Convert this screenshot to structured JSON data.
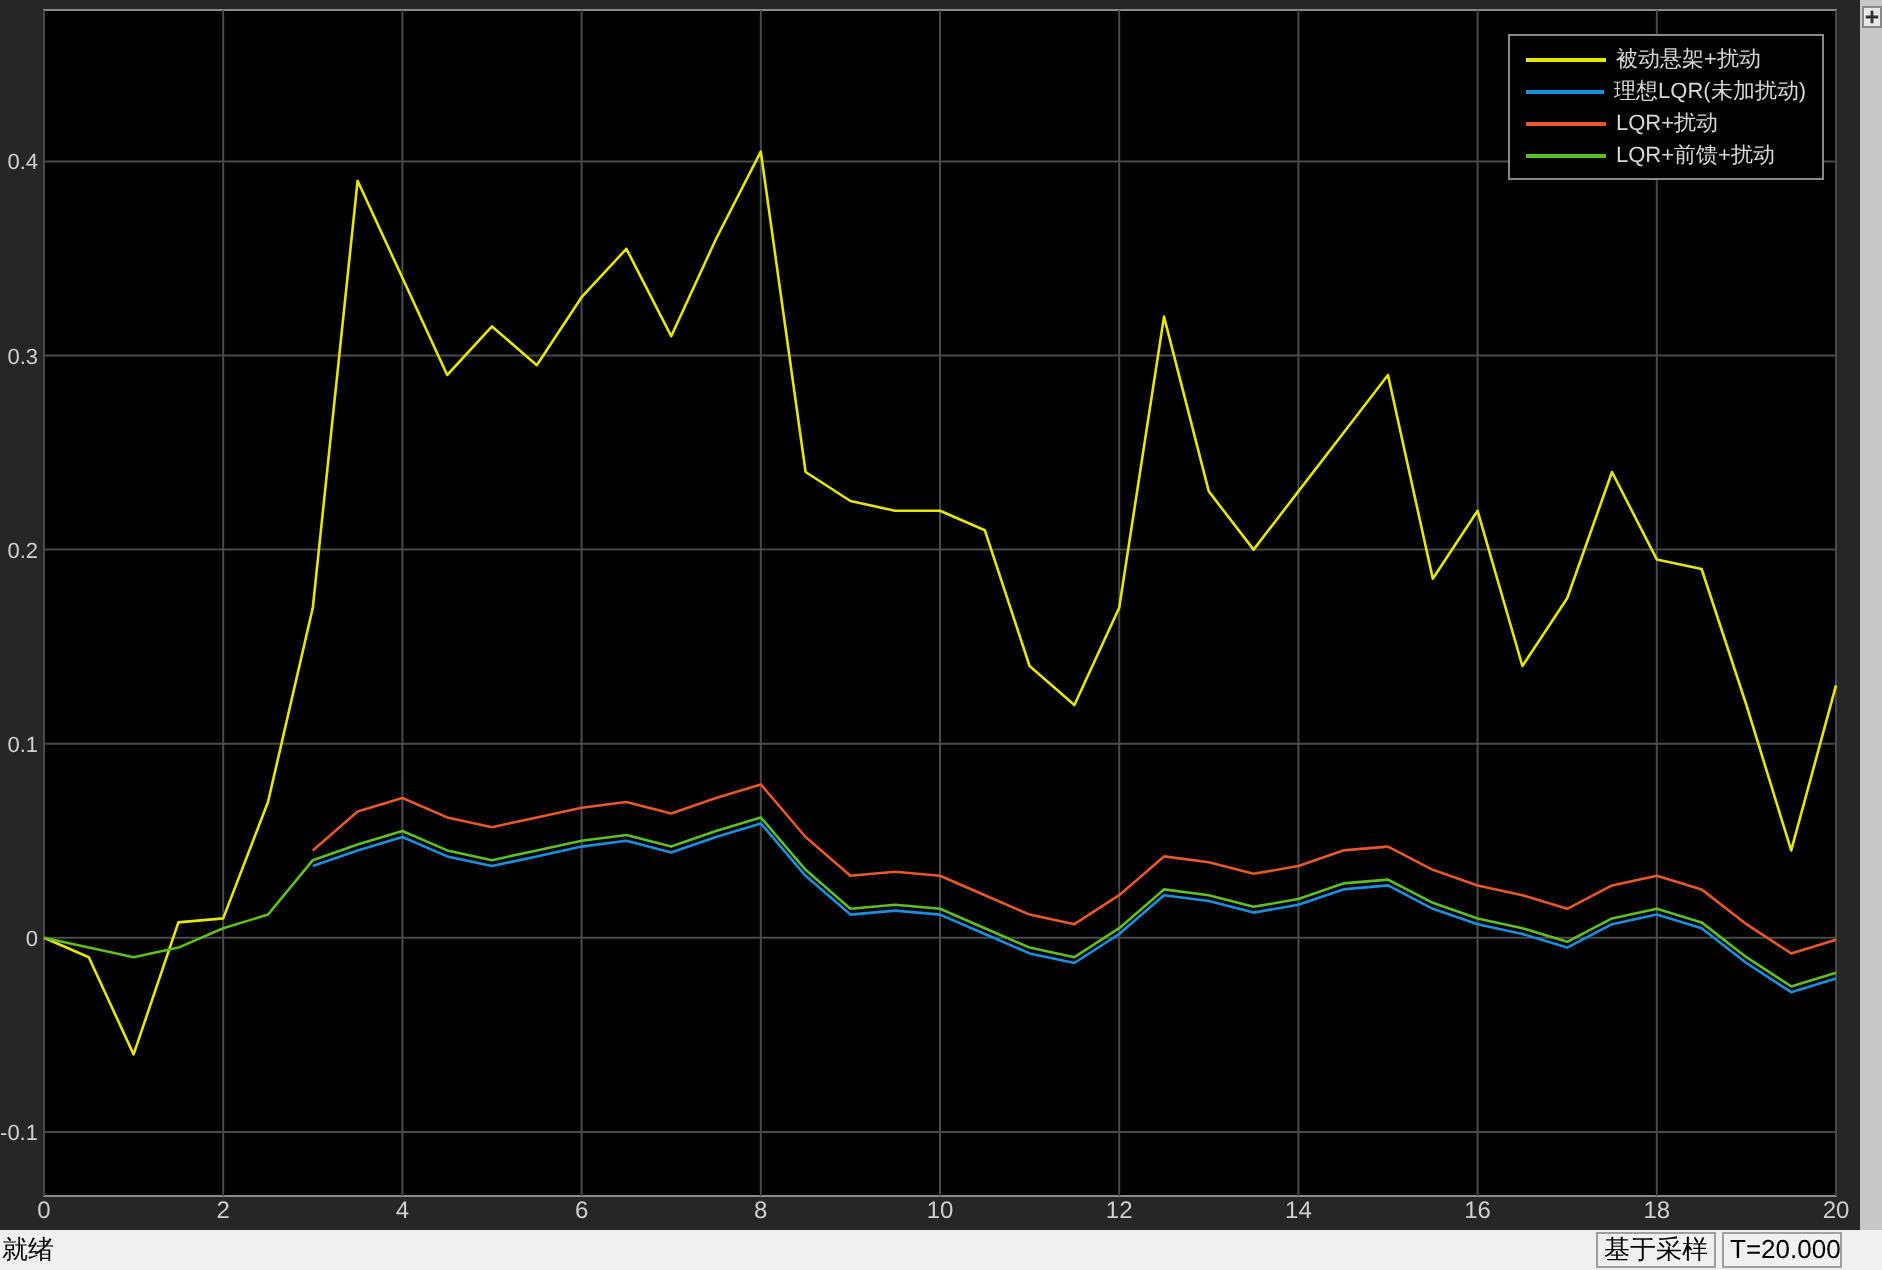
{
  "scope": {
    "chart_data": {
      "type": "line",
      "x": [
        0,
        0.5,
        1,
        1.5,
        2,
        2.5,
        3,
        3.5,
        4,
        4.5,
        5,
        5.5,
        6,
        6.5,
        7,
        7.5,
        8,
        8.5,
        9,
        9.5,
        10,
        10.5,
        11,
        11.5,
        12,
        12.5,
        13,
        13.5,
        14,
        14.5,
        15,
        15.5,
        16,
        16.5,
        17,
        17.5,
        18,
        18.5,
        19,
        19.5,
        20
      ],
      "xlim": [
        0,
        20
      ],
      "ylim": [
        -0.133,
        0.478
      ],
      "xticks": [
        0,
        2,
        4,
        6,
        8,
        10,
        12,
        14,
        16,
        18,
        20
      ],
      "grid": true,
      "legend": true,
      "yticks": [
        {
          "value": -0.1,
          "label": "-0.1"
        },
        0,
        0.1,
        0.2,
        0.3,
        0.4
      ],
      "series": [
        {
          "name": "被动悬架+扰动",
          "color": "#e6e600",
          "values": [
            0,
            -0.01,
            -0.06,
            0.008,
            0.01,
            0.07,
            0.17,
            0.39,
            0.34,
            0.29,
            0.315,
            0.295,
            0.33,
            0.355,
            0.31,
            0.36,
            0.405,
            0.24,
            0.225,
            0.22,
            0.22,
            0.21,
            0.14,
            0.12,
            0.17,
            0.32,
            0.23,
            0.2,
            0.23,
            0.26,
            0.29,
            0.185,
            0.22,
            0.14,
            0.175,
            0.24,
            0.195,
            0.19,
            0.12,
            0.045,
            0.13
          ]
        },
        {
          "name": "理想LQR(未加扰动)",
          "color": "#1a8fe0",
          "values": [
            null,
            null,
            null,
            null,
            null,
            null,
            0.037,
            0.045,
            0.052,
            0.042,
            0.037,
            0.042,
            0.047,
            0.05,
            0.044,
            0.052,
            0.059,
            0.032,
            0.012,
            0.014,
            0.012,
            0.002,
            -0.008,
            -0.013,
            0.002,
            0.022,
            0.019,
            0.013,
            0.017,
            0.025,
            0.027,
            0.015,
            0.007,
            0.002,
            -0.005,
            0.007,
            0.012,
            0.005,
            -0.013,
            -0.028,
            -0.021
          ]
        },
        {
          "name": "LQR+扰动",
          "color": "#e8582a",
          "values": [
            null,
            null,
            null,
            null,
            null,
            null,
            0.045,
            0.065,
            0.072,
            0.062,
            0.057,
            0.062,
            0.067,
            0.07,
            0.064,
            0.072,
            0.079,
            0.052,
            0.032,
            0.034,
            0.032,
            0.022,
            0.012,
            0.007,
            0.022,
            0.042,
            0.039,
            0.033,
            0.037,
            0.045,
            0.047,
            0.035,
            0.027,
            0.022,
            0.015,
            0.027,
            0.032,
            0.025,
            0.007,
            -0.008,
            -0.001
          ]
        },
        {
          "name": "LQR+前馈+扰动",
          "color": "#5fbf20",
          "values": [
            0,
            -0.005,
            -0.01,
            -0.005,
            0.005,
            0.012,
            0.04,
            0.048,
            0.055,
            0.045,
            0.04,
            0.045,
            0.05,
            0.053,
            0.047,
            0.055,
            0.062,
            0.035,
            0.015,
            0.017,
            0.015,
            0.005,
            -0.005,
            -0.01,
            0.005,
            0.025,
            0.022,
            0.016,
            0.02,
            0.028,
            0.03,
            0.018,
            0.01,
            0.005,
            -0.002,
            0.01,
            0.015,
            0.008,
            -0.01,
            -0.025,
            -0.018
          ]
        }
      ]
    }
  },
  "status_bar": {
    "message": "就绪",
    "mode": "基于采样",
    "time": "T=20.000"
  }
}
